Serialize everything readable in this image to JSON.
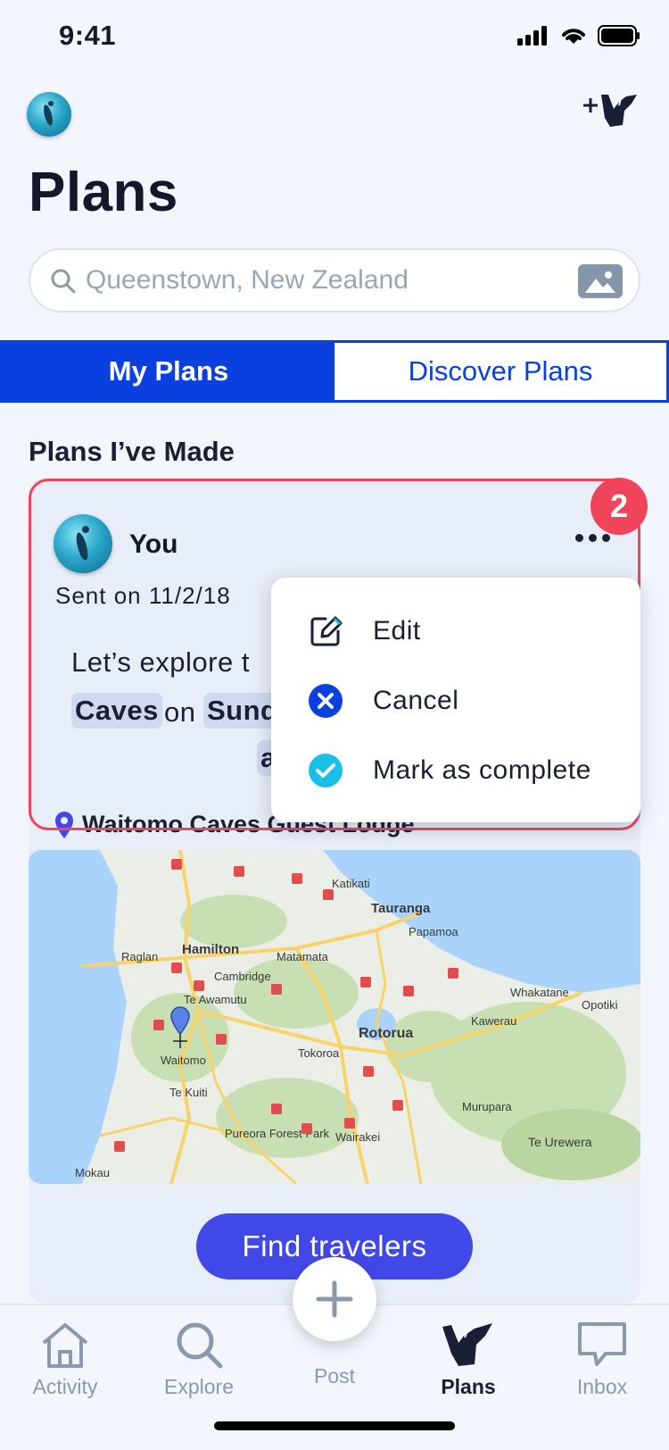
{
  "status_bar": {
    "time": "9:41"
  },
  "header": {
    "title": "Plans"
  },
  "search": {
    "placeholder": "Queenstown, New Zealand"
  },
  "tabs": [
    {
      "label": "My Plans",
      "active": true
    },
    {
      "label": "Discover Plans",
      "active": false
    }
  ],
  "section": {
    "title": "Plans I’ve Made"
  },
  "plan_card": {
    "badge": "2",
    "author": "You",
    "sent": "Sent on 11/2/18",
    "text_line1": "Let’s explore t",
    "chip1": "Caves",
    "connector": "on",
    "chip2": "Sund",
    "chip3": "a",
    "location": "Waitomo Caves Guest Lodge",
    "cta": "Find travelers"
  },
  "menu": {
    "items": [
      {
        "label": "Edit",
        "icon": "edit-icon"
      },
      {
        "label": "Cancel",
        "icon": "cancel-icon"
      },
      {
        "label": "Mark as complete",
        "icon": "check-icon"
      }
    ]
  },
  "map": {
    "labels": {
      "hamilton": "Hamilton",
      "raglan": "Raglan",
      "cambridge": "Cambridge",
      "matamata": "Matamata",
      "te_awamutu": "Te Awamutu",
      "waitomo": "Waitomo",
      "te_kuiti": "Te Kuiti",
      "tauranga": "Tauranga",
      "katikati": "Katikati",
      "papamoa": "Papamoa",
      "rotorua": "Rotorua",
      "tokoroa": "Tokoroa",
      "whakatane": "Whakatane",
      "opotiki": "Opotiki",
      "kawerau": "Kawerau",
      "murupara": "Murupara",
      "te_urewera": "Te Urewera",
      "pureora": "Pureora Forest Park",
      "wairakei": "Wairakei",
      "mokau": "Mokau"
    },
    "colors": {
      "sea": "#aad3fb",
      "land": "#eaeee6",
      "forest": "#c8dfb4",
      "road": "#f8d36a"
    }
  },
  "bottom_nav": {
    "items": [
      {
        "label": "Activity",
        "active": false
      },
      {
        "label": "Explore",
        "active": false
      },
      {
        "label": "Post",
        "active": false
      },
      {
        "label": "Plans",
        "active": true
      },
      {
        "label": "Inbox",
        "active": false
      }
    ]
  },
  "colors": {
    "brand_blue": "#0b40e0",
    "cta": "#4148e8",
    "alert": "#f0445a",
    "check": "#18c0e8"
  }
}
